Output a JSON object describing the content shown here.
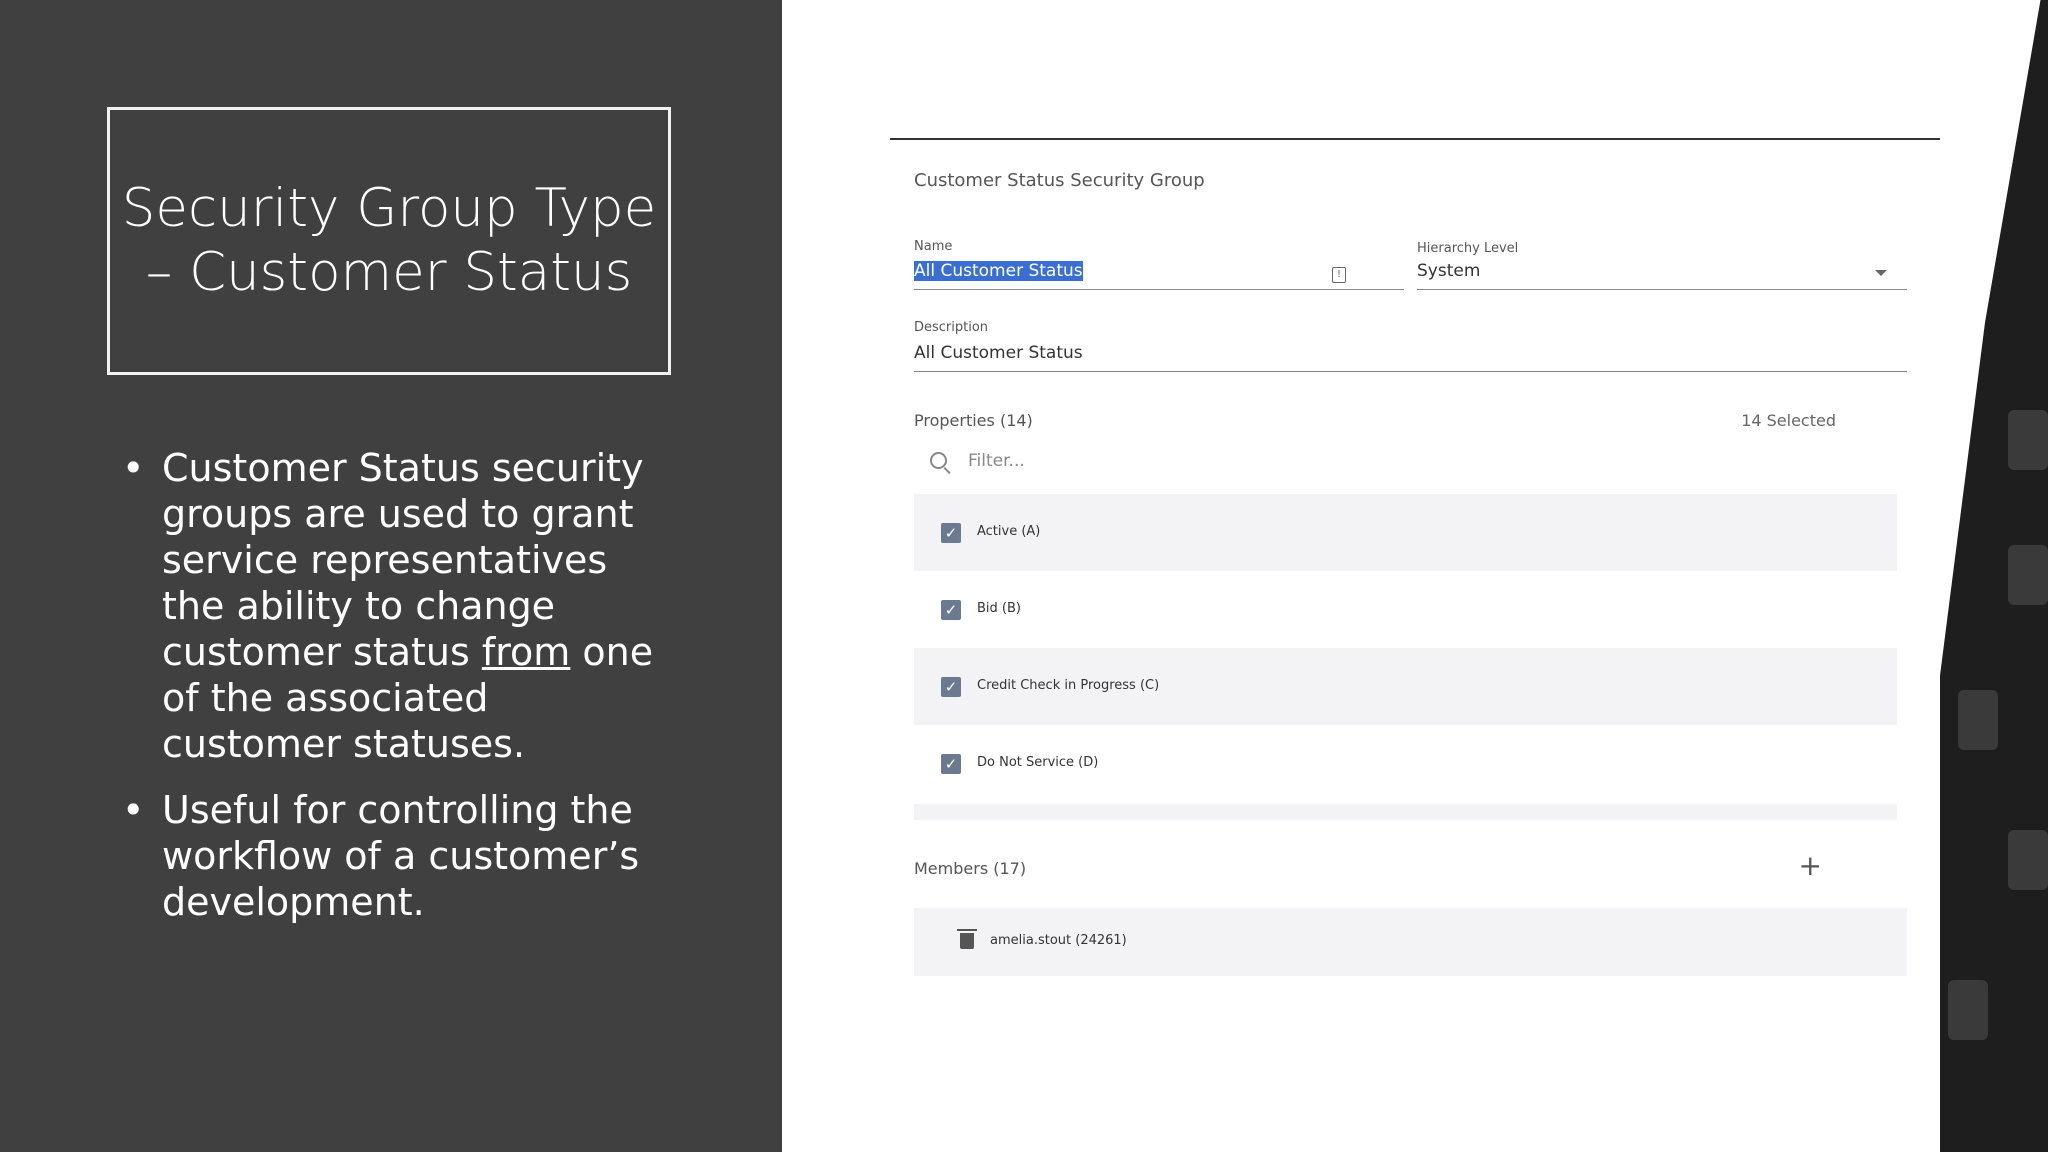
{
  "slide": {
    "title": "Security Group Type – Customer Status",
    "bullet1_pre": "Customer Status security groups are used to grant service representatives the ability to change customer status ",
    "bullet1_underlined": "from",
    "bullet1_post": " one of the associated customer statuses.",
    "bullet2": "Useful for controlling the workflow of a customer’s development."
  },
  "form": {
    "section_title": "Customer Status Security Group",
    "name_label": "Name",
    "name_value": "All Customer Status",
    "hierarchy_label": "Hierarchy Level",
    "hierarchy_value": "System",
    "description_label": "Description",
    "description_value": "All Customer Status",
    "properties_label": "Properties (14)",
    "properties_selected": "14 Selected",
    "filter_placeholder": "Filter...",
    "properties": [
      {
        "label": "Active (A)",
        "checked": true
      },
      {
        "label": "Bid (B)",
        "checked": true
      },
      {
        "label": "Credit Check in Progress (C)",
        "checked": true
      },
      {
        "label": "Do Not Service (D)",
        "checked": true
      }
    ],
    "members_label": "Members (17)",
    "members_add_icon": "plus-icon",
    "members": [
      {
        "label": "amelia.stout (24261)"
      }
    ]
  },
  "colors": {
    "slide_bg": "#404040",
    "selection": "#3a6fd1",
    "checkbox": "#6b7a90"
  }
}
